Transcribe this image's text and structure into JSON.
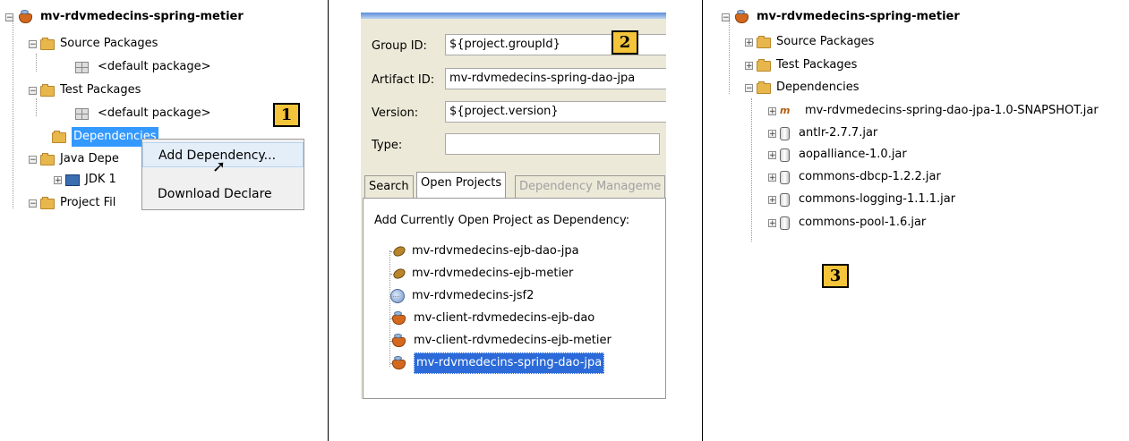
{
  "panel1": {
    "project_name": "mv-rdvmedecins-spring-metier",
    "source_packages": "Source Packages",
    "default_package_1": "<default package>",
    "test_packages": "Test Packages",
    "default_package_2": "<default package>",
    "dependencies": "Dependencies",
    "java_dependencies": "Java Depe",
    "jdk": "JDK 1",
    "project_files": "Project Fil",
    "context_menu": {
      "add_dependency": "Add Dependency...",
      "download_declared": "Download Declare"
    },
    "badge": "1"
  },
  "panel2": {
    "group_id_label": "Group ID:",
    "group_id_value": "${project.groupId}",
    "artifact_id_label": "Artifact ID:",
    "artifact_id_value": "mv-rdvmedecins-spring-dao-jpa",
    "version_label": "Version:",
    "version_value": "${project.version}",
    "type_label": "Type:",
    "type_value": "",
    "badge": "2",
    "tabs": [
      "Search",
      "Open Projects",
      "Dependency Manageme"
    ],
    "list_header": "Add Currently Open Project as Dependency:",
    "projects": [
      "mv-rdvmedecins-ejb-dao-jpa",
      "mv-rdvmedecins-ejb-metier",
      "mv-rdvmedecins-jsf2",
      "mv-client-rdvmedecins-ejb-dao",
      "mv-client-rdvmedecins-ejb-metier",
      "mv-rdvmedecins-spring-dao-jpa"
    ]
  },
  "panel3": {
    "project_name": "mv-rdvmedecins-spring-metier",
    "source_packages": "Source Packages",
    "test_packages": "Test Packages",
    "dependencies": "Dependencies",
    "jars": [
      "mv-rdvmedecins-spring-dao-jpa-1.0-SNAPSHOT.jar",
      "antlr-2.7.7.jar",
      "aopalliance-1.0.jar",
      "commons-dbcp-1.2.2.jar",
      "commons-logging-1.1.1.jar",
      "commons-pool-1.6.jar"
    ],
    "maven_icon_text": "m",
    "badge": "3"
  },
  "colors": {
    "selection": "#3399ff",
    "badge": "#f4c43a",
    "folder": "#e7b74c"
  }
}
